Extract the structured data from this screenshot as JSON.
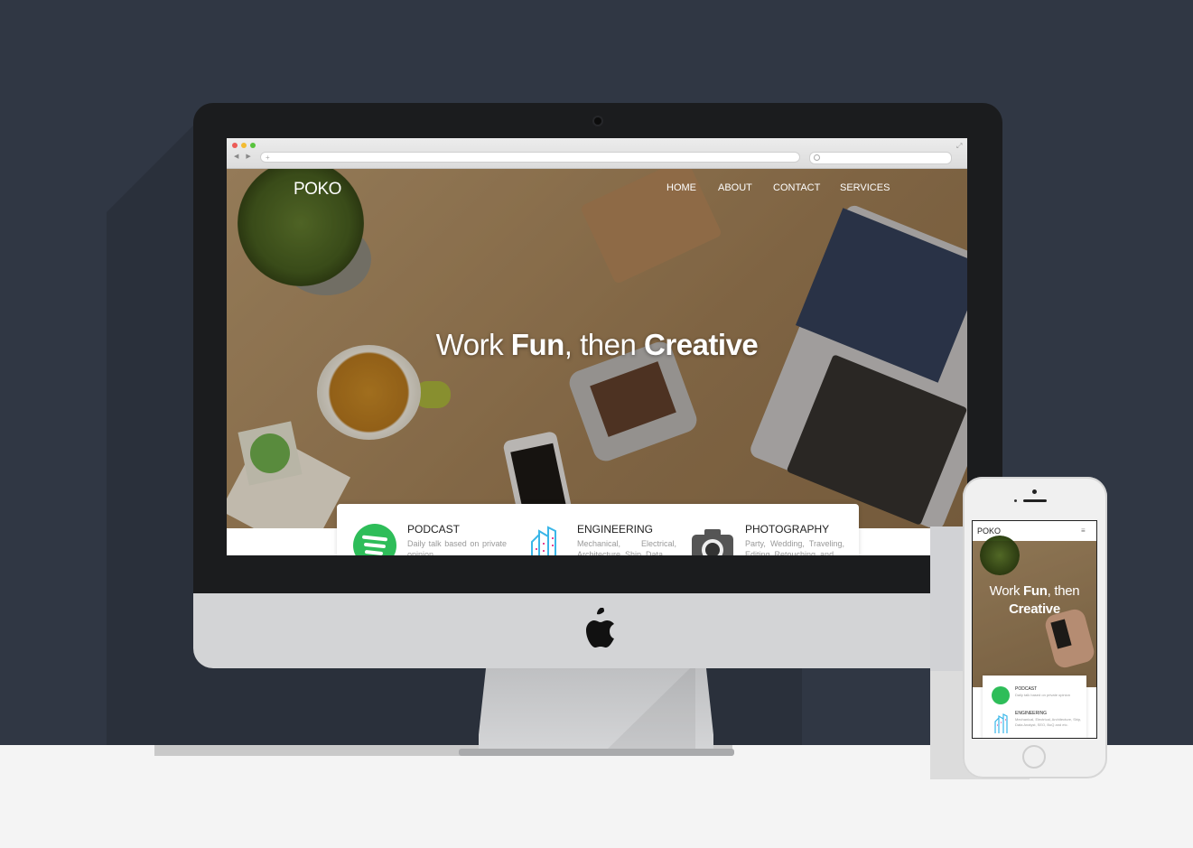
{
  "desktop": {
    "browser": {
      "back_forward": "◀ ▶",
      "new_tab": "+"
    },
    "site": {
      "logo": "POKO",
      "nav": [
        "HOME",
        "ABOUT",
        "CONTACT",
        "SERVICES"
      ],
      "hero": {
        "w1": "Work",
        "w2": "Fun",
        "w3": ", then",
        "w4": "Creative"
      },
      "services": [
        {
          "title": "PODCAST",
          "desc": "Daily talk based on private opinion"
        },
        {
          "title": "ENGINEERING",
          "desc": "Mechanical, Electrical, Architecture, Ship, Data"
        },
        {
          "title": "PHOTOGRAPHY",
          "desc": "Party, Wedding, Traveling, Editing, Retouching, and"
        }
      ]
    }
  },
  "mobile": {
    "logo": "POKO",
    "menu_icon": "≡",
    "hero": {
      "w1": "Work",
      "w2": "Fun",
      "w3": ", then",
      "w4": "Creative"
    },
    "services": [
      {
        "title": "PODCAST",
        "desc": "Daily talk based on private opinion"
      },
      {
        "title": "ENGINEERING",
        "desc": "Mechanical, Electrical, Architecture, Ship, Data Analyst, SEO, BoQ and etc."
      }
    ]
  },
  "colors": {
    "background": "#303744",
    "spotify_green": "#2ebd59",
    "floor": "#f4f4f4"
  }
}
